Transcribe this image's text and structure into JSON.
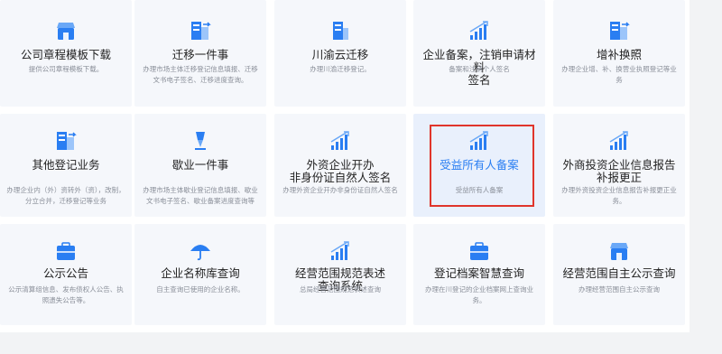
{
  "services": [
    {
      "title": "公司章程模板下载",
      "desc": "提供公司章程模板下载。",
      "icon": "store-icon"
    },
    {
      "title": "迁移一件事",
      "desc": "办理市场主体迁移登记信息填报、迁移文书电子签名、迁移进度查询。",
      "icon": "transfer-icon"
    },
    {
      "title": "川渝云迁移",
      "desc": "办理川渝迁移登记。",
      "icon": "building-icon"
    },
    {
      "title": "企业备案，注销申请材料\n签名",
      "desc": "备案和注销个人签名",
      "icon": "bar-chart-icon"
    },
    {
      "title": "增补换照",
      "desc": "办理企业增、补、换营业执照登记等业务",
      "icon": "transfer-icon"
    },
    {
      "title": "其他登记业务",
      "desc": "办理企业内（外）资转外（资），改制，分立合并，迁移登记等业务",
      "icon": "transfer-icon"
    },
    {
      "title": "歇业一件事",
      "desc": "办理市场主体歇业登记信息填报、歇业文书电子签名、歇业备案进度查询等",
      "icon": "pen-icon"
    },
    {
      "title": "外资企业开办\n非身份证自然人签名",
      "desc": "办理外资企业开办非身份证自然人签名",
      "icon": "bar-chart-icon"
    },
    {
      "title": "受益所有人备案",
      "desc": "受益所有人备案",
      "icon": "bar-chart-icon"
    },
    {
      "title": "外商投资企业信息报告\n补报更正",
      "desc": "办理外资投资企业信息报告补报更正业务。",
      "icon": "bar-chart-icon"
    },
    {
      "title": "公示公告",
      "desc": "公示清算组信息、发布债权人公告、执照遗失公告等。",
      "icon": "briefcase-icon"
    },
    {
      "title": "企业名称库查询",
      "desc": "自主查询已使用的企业名称。",
      "icon": "umbrella-icon"
    },
    {
      "title": "经营范围规范表述\n查询系统",
      "desc": "总局经营范围规范表述查询",
      "icon": "bar-chart-icon"
    },
    {
      "title": "登记档案智慧查询",
      "desc": "办理在川登记的企业档案网上查询业务。",
      "icon": "briefcase-icon"
    },
    {
      "title": "经营范围自主公示查询",
      "desc": "办理经营范围自主公示查询",
      "icon": "store-icon"
    }
  ],
  "active_service": "受益所有人备案",
  "colors": {
    "icon_blue": "#2a7ef2",
    "active_title": "#2a7ef2",
    "highlight_border": "#e0352b",
    "card_bg": "#f5f7fb",
    "active_card_bg": "#e9f0fc"
  }
}
